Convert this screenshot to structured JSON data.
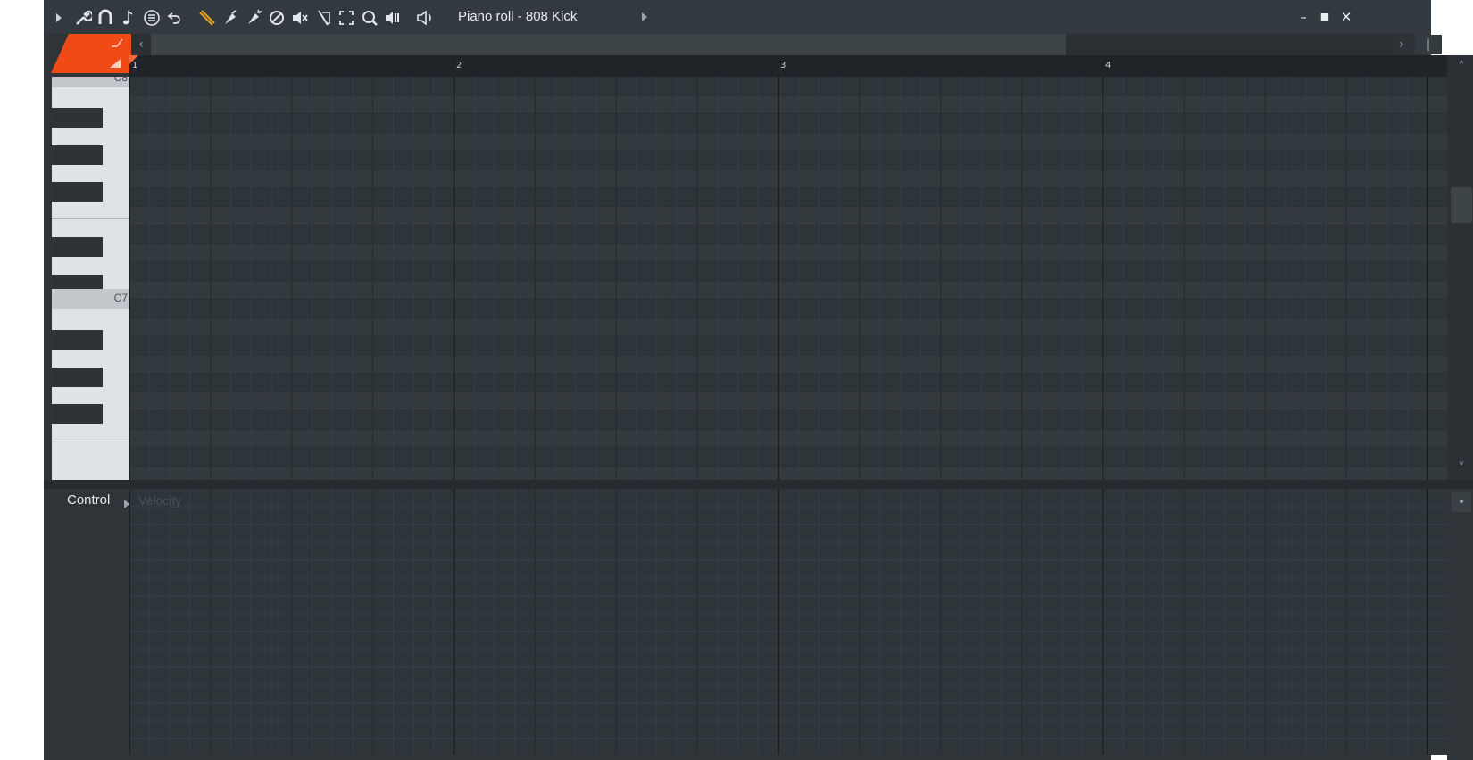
{
  "toolbar": {
    "icons": [
      "play-arrow",
      "wrench",
      "magnet",
      "note",
      "list",
      "undo",
      "pencil",
      "paint",
      "paint-special",
      "delete",
      "mute",
      "slice",
      "select",
      "zoom",
      "playback"
    ],
    "title": "Piano roll - 808 Kick"
  },
  "window_controls": {
    "minimize": "–",
    "maximize": "■",
    "close": "✕"
  },
  "ruler": {
    "bars": [
      "1",
      "2",
      "3",
      "4"
    ]
  },
  "keyboard": {
    "labels": [
      "C8",
      "C7"
    ]
  },
  "control": {
    "label": "Control",
    "parameter": "Velocity"
  },
  "colors": {
    "accent": "#f04a16",
    "grid_bg": "#2e3539",
    "grid_alt": "#333a3e"
  }
}
